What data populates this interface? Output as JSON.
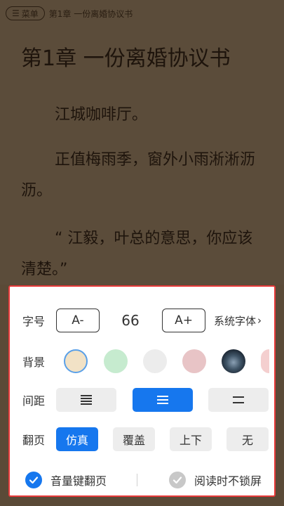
{
  "topbar": {
    "menu_label": "菜单",
    "breadcrumb": "第1章 一份离婚协议书"
  },
  "content": {
    "chapter_title": "第1章 一份离婚协议书",
    "paragraphs": [
      "江城咖啡厅。",
      "正值梅雨季，窗外小雨淅淅沥沥。",
      "“ 江毅，叶总的意思，你应该清楚。”"
    ]
  },
  "settings": {
    "font_label": "字号",
    "font_decrease": "A-",
    "font_size": "66",
    "font_increase": "A+",
    "font_family": "系统字体",
    "background_label": "背景",
    "background_colors": [
      "#f2e2c6",
      "#c6ebcf",
      "#ececec",
      "#e8c4c6",
      "#2c3a48",
      "#f4cfcf"
    ],
    "spacing_label": "间距",
    "page_turn_label": "翻页",
    "page_turn_options": [
      "仿真",
      "覆盖",
      "上下",
      "无"
    ],
    "volume_key_label": "音量键翻页",
    "no_lock_label": "阅读时不锁屏",
    "accent_color": "#1677ee",
    "highlight_border_color": "#e83a3a"
  }
}
